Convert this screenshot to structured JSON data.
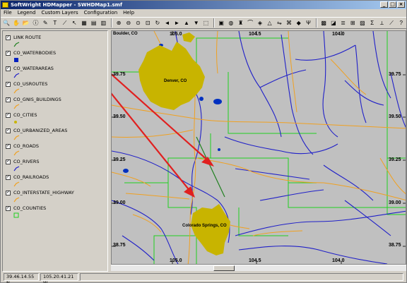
{
  "window": {
    "title": "SoftWright HDMapper - SWHDMap1.smf"
  },
  "menu": [
    "File",
    "Legend",
    "Custom Layers",
    "Configuration",
    "Help"
  ],
  "layers": [
    {
      "name": "LINK ROUTE",
      "checked": true,
      "symbol": "green-line"
    },
    {
      "name": "CO_WATERBODIES",
      "checked": true,
      "symbol": "blue-square"
    },
    {
      "name": "CO_WATERAREAS",
      "checked": true,
      "symbol": "blue-line"
    },
    {
      "name": "CO_USROUTES",
      "checked": true,
      "symbol": "orange-line"
    },
    {
      "name": "CO_GNIS_BUILDINGS",
      "checked": true,
      "symbol": "orange-line"
    },
    {
      "name": "CO_CITIES",
      "checked": true,
      "symbol": "yellow-dot"
    },
    {
      "name": "CO_URBANIZED_AREAS",
      "checked": true,
      "symbol": "orange-line"
    },
    {
      "name": "CO_ROADS",
      "checked": true,
      "symbol": "orange-line"
    },
    {
      "name": "CO_RIVERS",
      "checked": true,
      "symbol": "blue-line"
    },
    {
      "name": "CO_RAILROADS",
      "checked": true,
      "symbol": "orange-line"
    },
    {
      "name": "CO_INTERSTATE_HIGHWAY",
      "checked": true,
      "symbol": "orange-line"
    },
    {
      "name": "CO_COUNTIES",
      "checked": true,
      "symbol": "green-square"
    }
  ],
  "map": {
    "top_labels": [
      "Boulder, CO",
      "105.0",
      "104.5",
      "104.0"
    ],
    "bottom_labels": [
      "105.0",
      "104.5",
      "104.0"
    ],
    "left_labels": [
      "39.75",
      "39.50",
      "39.25",
      "39.00",
      "38.75"
    ],
    "right_labels": [
      "39.75",
      "39.50",
      "39.25",
      "39.00",
      "38.75"
    ],
    "cities": [
      "Denver, CO",
      "Colorado Springs, CO"
    ],
    "colors": {
      "background": "#c0c0c0",
      "urban": "#c8b400",
      "rivers": "#2020c8",
      "roads": "#f0a020",
      "counties": "#20d020",
      "arrows": "#e02020",
      "link": "#208020"
    }
  },
  "status": {
    "lat": "39.46.14.55 N",
    "lon": "105.20.41.21 W"
  }
}
